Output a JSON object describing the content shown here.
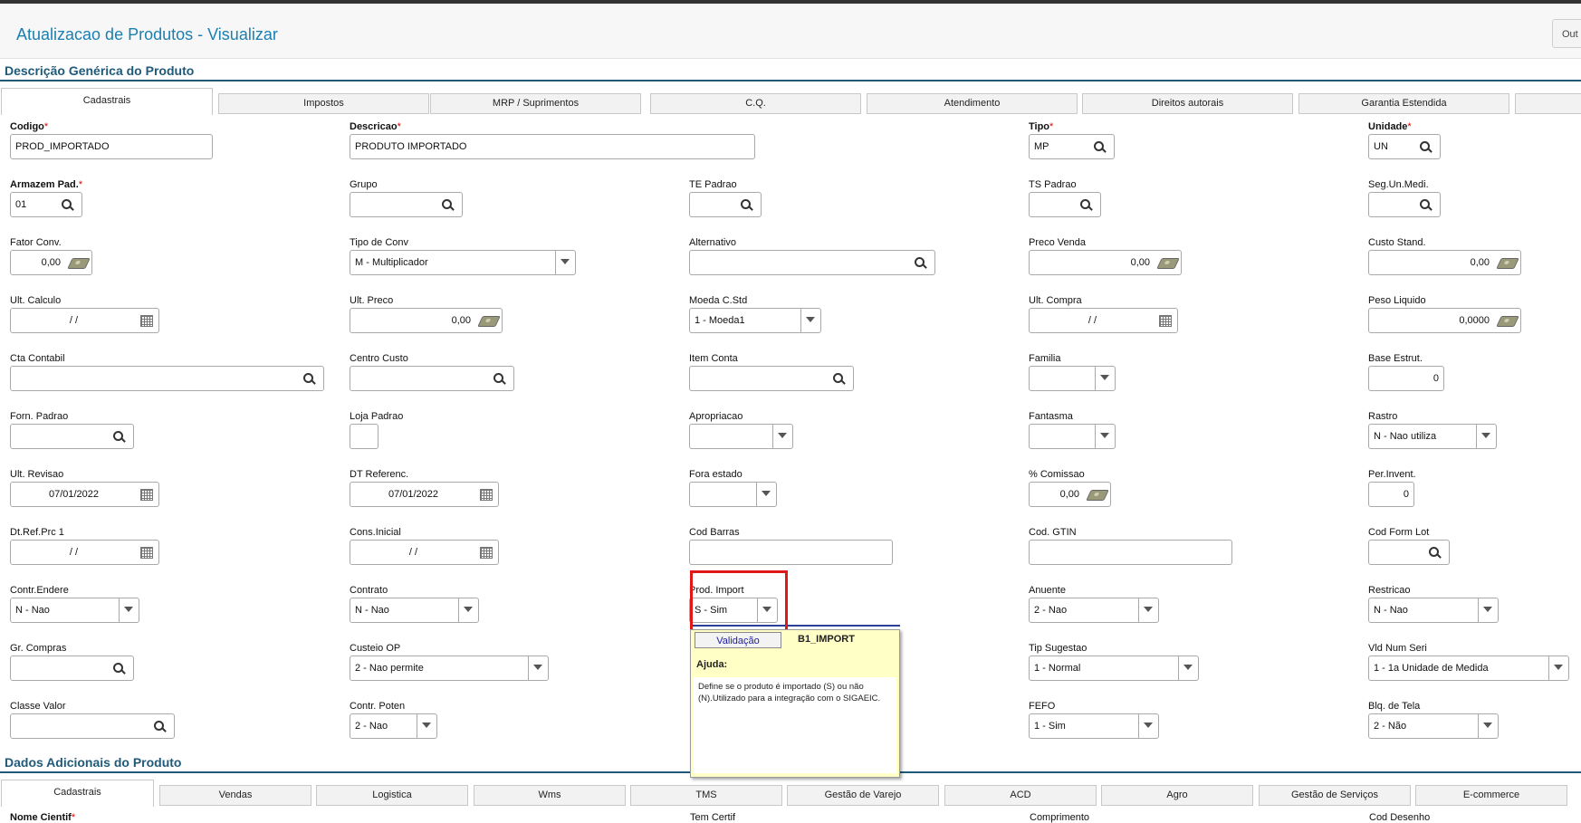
{
  "header": {
    "title": "Atualizacao de Produtos - Visualizar",
    "other_label": "Out"
  },
  "sections": {
    "generic_title": "Descrição Genérica do Produto",
    "additional_title": "Dados Adicionais do Produto"
  },
  "tabs_top": [
    "Cadastrais",
    "Impostos",
    "MRP / Suprimentos",
    "C.Q.",
    "Atendimento",
    "Direitos autorais",
    "Garantia Estendida",
    ""
  ],
  "tabs_bottom": [
    "Cadastrais",
    "Vendas",
    "Logistica",
    "Wms",
    "TMS",
    "Gestão de Varejo",
    "ACD",
    "Agro",
    "Gestão de Serviços",
    "E-commerce"
  ],
  "fields": {
    "codigo": {
      "label": "Codigo",
      "value": "PROD_IMPORTADO"
    },
    "descricao": {
      "label": "Descricao",
      "value": "PRODUTO IMPORTADO"
    },
    "tipo": {
      "label": "Tipo",
      "value": "MP"
    },
    "unidade": {
      "label": "Unidade",
      "value": "UN"
    },
    "armazem_pad": {
      "label": "Armazem Pad.",
      "value": "01"
    },
    "grupo": {
      "label": "Grupo",
      "value": ""
    },
    "te_padrao": {
      "label": "TE Padrao",
      "value": ""
    },
    "ts_padrao": {
      "label": "TS Padrao",
      "value": ""
    },
    "seg_un_medi": {
      "label": "Seg.Un.Medi.",
      "value": ""
    },
    "fator_conv": {
      "label": "Fator Conv.",
      "value": "0,00"
    },
    "tipo_de_conv": {
      "label": "Tipo de Conv",
      "value": "M - Multiplicador"
    },
    "alternativo": {
      "label": "Alternativo",
      "value": ""
    },
    "preco_venda": {
      "label": "Preco Venda",
      "value": "0,00"
    },
    "custo_stand": {
      "label": "Custo Stand.",
      "value": "0,00"
    },
    "ult_calculo": {
      "label": "Ult. Calculo",
      "value": "/ /"
    },
    "ult_preco": {
      "label": "Ult. Preco",
      "value": "0,00"
    },
    "moeda_c_std": {
      "label": "Moeda C.Std",
      "value": "1 - Moeda1"
    },
    "ult_compra": {
      "label": "Ult. Compra",
      "value": "/ /"
    },
    "peso_liquido": {
      "label": "Peso Liquido",
      "value": "0,0000"
    },
    "cta_contabil": {
      "label": "Cta Contabil",
      "value": ""
    },
    "centro_custo": {
      "label": "Centro Custo",
      "value": ""
    },
    "item_conta": {
      "label": "Item Conta",
      "value": ""
    },
    "familia": {
      "label": "Familia",
      "value": ""
    },
    "base_estrut": {
      "label": "Base Estrut.",
      "value": "0"
    },
    "forn_padrao": {
      "label": "Forn. Padrao",
      "value": ""
    },
    "loja_padrao": {
      "label": "Loja Padrao",
      "value": ""
    },
    "apropriacao": {
      "label": "Apropriacao",
      "value": ""
    },
    "fantasma": {
      "label": "Fantasma",
      "value": ""
    },
    "rastro": {
      "label": "Rastro",
      "value": "N - Nao utiliza"
    },
    "ult_revisao": {
      "label": "Ult. Revisao",
      "value": "07/01/2022"
    },
    "dt_referenc": {
      "label": "DT Referenc.",
      "value": "07/01/2022"
    },
    "fora_estado": {
      "label": "Fora estado",
      "value": ""
    },
    "comissao": {
      "label": "% Comissao",
      "value": "0,00"
    },
    "per_invent": {
      "label": "Per.Invent.",
      "value": "0"
    },
    "dt_ref_prc_1": {
      "label": "Dt.Ref.Prc 1",
      "value": "/ /"
    },
    "cons_inicial": {
      "label": "Cons.Inicial",
      "value": "/ /"
    },
    "cod_barras": {
      "label": "Cod Barras",
      "value": ""
    },
    "cod_gtin": {
      "label": "Cod. GTIN",
      "value": ""
    },
    "cod_form_lot": {
      "label": "Cod Form Lot",
      "value": ""
    },
    "contr_endere": {
      "label": "Contr.Endere",
      "value": "N - Nao"
    },
    "contrato": {
      "label": "Contrato",
      "value": "N - Nao"
    },
    "prod_import": {
      "label": "Prod. Import",
      "value": "S - Sim"
    },
    "anuente": {
      "label": "Anuente",
      "value": "2 - Nao"
    },
    "restricao": {
      "label": "Restricao",
      "value": "N - Nao"
    },
    "gr_compras": {
      "label": "Gr. Compras",
      "value": ""
    },
    "custeio_op": {
      "label": "Custeio OP",
      "value": "2 - Nao permite"
    },
    "tip_sugestao": {
      "label": "Tip Sugestao",
      "value": "1 - Normal"
    },
    "vld_num_seri": {
      "label": "Vld Num Seri",
      "value": "1 - 1a Unidade de Medida"
    },
    "classe_valor": {
      "label": "Classe Valor",
      "value": ""
    },
    "contr_poten": {
      "label": "Contr. Poten",
      "value": "2 - Nao"
    },
    "fefo": {
      "label": "FEFO",
      "value": "1 - Sim"
    },
    "blq_de_tela": {
      "label": "Blq. de Tela",
      "value": "2 - Não"
    }
  },
  "bottom_labels": {
    "nome_cientif": "Nome Cientif",
    "tem_certif": "Tem Certif",
    "comprimento": "Comprimento",
    "cod_desenho": "Cod Desenho"
  },
  "tooltip": {
    "button_label": "Validação",
    "field_name": "B1_IMPORT",
    "help_title": "Ajuda:",
    "help_text": "Define se o produto é importado (S) ou não (N).Utilizado para a integração com o SIGAEIC."
  }
}
